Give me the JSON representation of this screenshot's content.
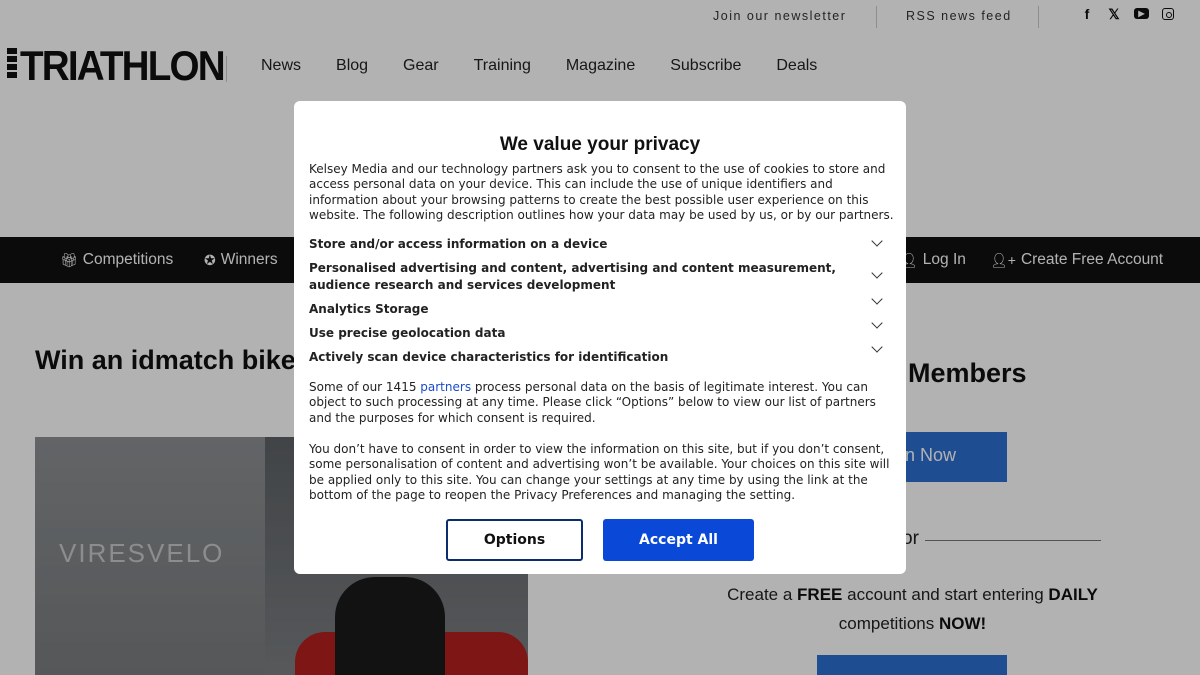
{
  "topbar": {
    "newsletter": "Join our newsletter",
    "rss": "RSS news feed",
    "social_icons": [
      "facebook-icon",
      "x-icon",
      "youtube-icon",
      "instagram-icon"
    ],
    "facebook_glyph": "f",
    "x_glyph": "𝕏",
    "youtube_glyph": "▶"
  },
  "header": {
    "logo": "TRIATHLON",
    "nav": [
      "News",
      "Blog",
      "Gear",
      "Training",
      "Magazine",
      "Subscribe",
      "Deals"
    ]
  },
  "blackbar": {
    "competitions": "Competitions",
    "winners": "Winners",
    "login": "Log In",
    "create_account": "Create Free Account"
  },
  "article": {
    "title": "Win an idmatch bike fit at Silverstone",
    "image_brand": "VIRESVELO"
  },
  "sidebar": {
    "members_heading": "Members",
    "join_label": "n Now",
    "or": "or",
    "create_pre": "Create a ",
    "create_free": "FREE",
    "create_mid": " account and start entering ",
    "create_daily": "DAILY",
    "create_post": " competitions ",
    "create_now": "NOW!"
  },
  "modal": {
    "title": "We value your privacy",
    "intro": "Kelsey Media and our technology partners ask you to consent to the use of cookies to store and access personal data on your device. This can include the use of unique identifiers and information about your browsing patterns to create the best possible user experience on this website. The following description outlines how your data may be used by us, or by our partners.",
    "purposes": [
      "Store and/or access information on a device",
      "Personalised advertising and content, advertising and content measurement, audience research and services development",
      "Analytics Storage",
      "Use precise geolocation data",
      "Actively scan device characteristics for identification"
    ],
    "partners_pre": "Some of our 1415 ",
    "partners_link": "partners",
    "partners_post": " process personal data on the basis of legitimate interest. You can object to such processing at any time. Please click “Options” below to view our list of partners and the purposes for which consent is required.",
    "consent_note": "You don’t have to consent in order to view the information on this site, but if you don’t consent, some personalisation of content and advertising won’t be available. Your choices on this site will be applied only to this site. You can change your settings at any time by using the link at the bottom of the page to reopen the Privacy Preferences and managing the setting.",
    "options_label": "Options",
    "accept_label": "Accept All",
    "accept_color": "#0a49d8"
  }
}
